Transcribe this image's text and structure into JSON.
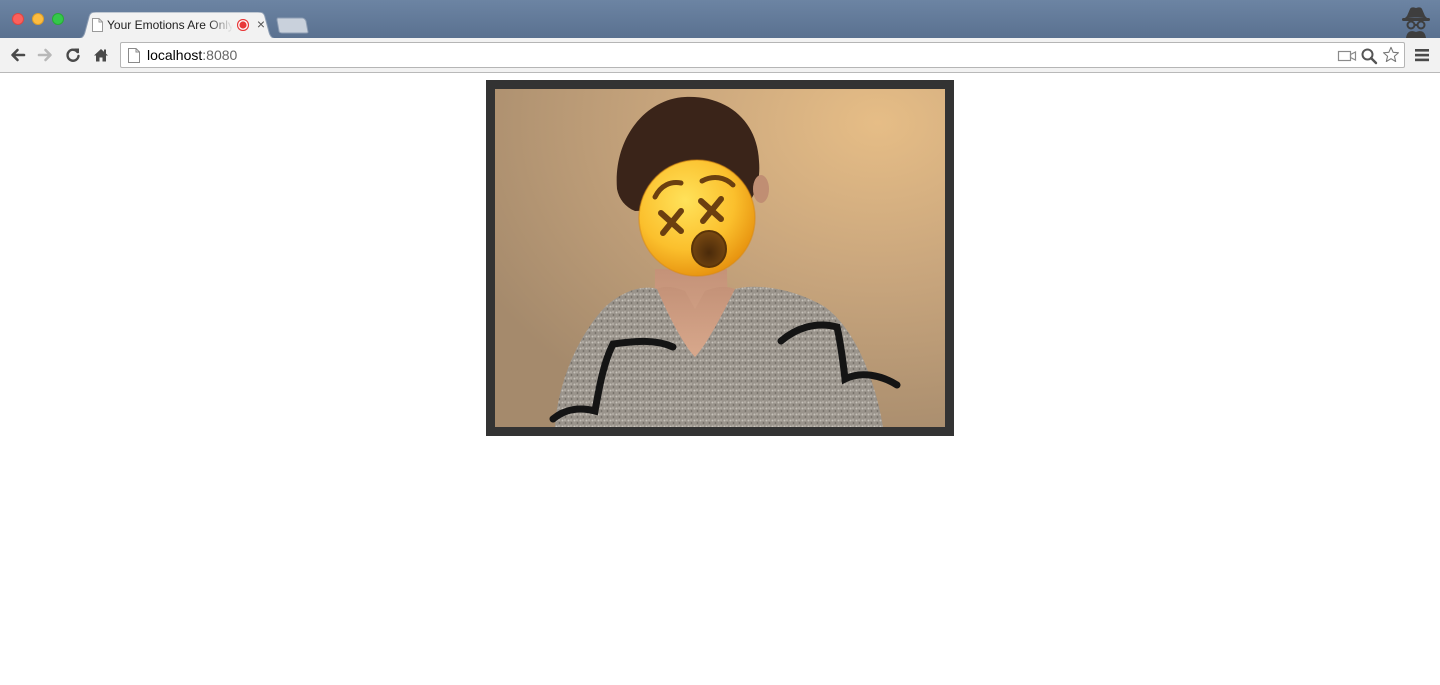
{
  "window": {
    "tab": {
      "title": "Your Emotions Are Only Yours",
      "recording_indicator": "recording-dot-icon",
      "close_glyph": "×"
    },
    "new_tab": "new-tab-button"
  },
  "toolbar": {
    "back": "back-arrow-icon",
    "forward": "forward-arrow-icon",
    "reload": "reload-icon",
    "home": "home-icon",
    "address": {
      "host": "localhost",
      "port": ":8080"
    },
    "omnibox_icons": [
      "camera-icon",
      "zoom-icon",
      "bookmark-star-icon"
    ],
    "menu": "hamburger-menu-icon"
  },
  "page": {
    "webcam": {
      "overlay_emoji": "dizzy-face-emoji"
    }
  },
  "colors": {
    "titlebar": "#6a82a1",
    "tab_active": "#f2f2f2",
    "frame_border": "#333333",
    "record_red": "#e8393a"
  }
}
